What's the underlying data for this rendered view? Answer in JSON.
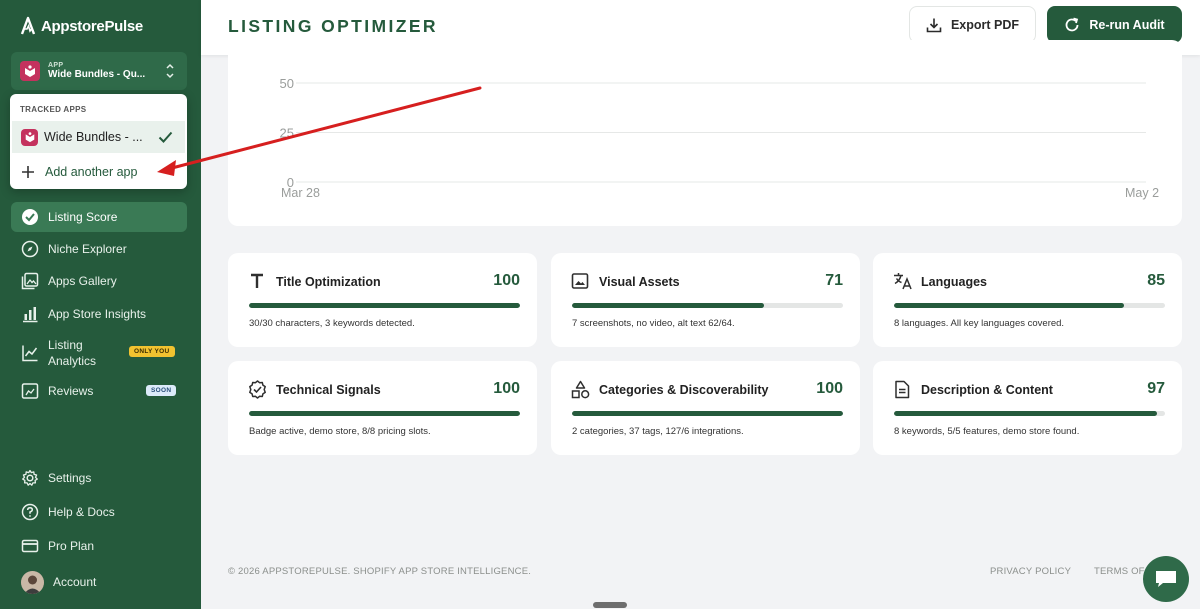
{
  "brand": {
    "name": "AppstorePulse"
  },
  "app_switcher": {
    "caption": "APP",
    "name": "Wide Bundles - Qu..."
  },
  "dropdown": {
    "title": "TRACKED APPS",
    "selected_app": "Wide Bundles - ...",
    "add_label": "Add another app"
  },
  "nav": {
    "listing_score": "Listing Score",
    "niche_explorer": "Niche Explorer",
    "apps_gallery": "Apps Gallery",
    "app_store_insights": "App Store Insights",
    "listing_analytics_line1": "Listing",
    "listing_analytics_line2": "Analytics",
    "only_you_badge": "ONLY YOU",
    "reviews": "Reviews",
    "soon_badge": "SOON",
    "settings": "Settings",
    "help": "Help & Docs",
    "pro_plan": "Pro Plan",
    "account": "Account"
  },
  "header": {
    "title": "LISTING OPTIMIZER",
    "export_label": "Export PDF",
    "rerun_label": "Re-run Audit"
  },
  "chart_data": {
    "type": "line",
    "x_ticks": [
      "Mar 28",
      "May 2"
    ],
    "y_ticks": [
      0,
      25,
      50
    ],
    "ylim": [
      0,
      50
    ]
  },
  "cards": [
    {
      "title": "Title Optimization",
      "score": "100",
      "progress": 1.0,
      "desc": "30/30 characters, 3 keywords detected.",
      "icon": "text-icon"
    },
    {
      "title": "Visual Assets",
      "score": "71",
      "progress": 0.71,
      "desc": "7 screenshots, no video, alt text 62/64.",
      "icon": "image-icon"
    },
    {
      "title": "Languages",
      "score": "85",
      "progress": 0.85,
      "desc": "8 languages. All key languages covered.",
      "icon": "translate-icon"
    },
    {
      "title": "Technical Signals",
      "score": "100",
      "progress": 1.0,
      "desc": "Badge active, demo store, 8/8 pricing slots.",
      "icon": "badge-check-icon"
    },
    {
      "title": "Categories & Discoverability",
      "score": "100",
      "progress": 1.0,
      "desc": "2 categories, 37 tags, 127/6 integrations.",
      "icon": "shapes-icon"
    },
    {
      "title": "Description & Content",
      "score": "97",
      "progress": 0.97,
      "desc": "8 keywords, 5/5 features, demo store found.",
      "icon": "document-icon"
    }
  ],
  "footer": {
    "copyright": "© 2026 APPSTOREPULSE. SHOPIFY APP STORE INTELLIGENCE.",
    "privacy": "PRIVACY POLICY",
    "terms": "TERMS OF"
  },
  "colors": {
    "sidebar": "#255a3c",
    "accent": "#255a3c",
    "annotation_arrow": "#d61f1f",
    "app_icon": "#c4325e"
  }
}
